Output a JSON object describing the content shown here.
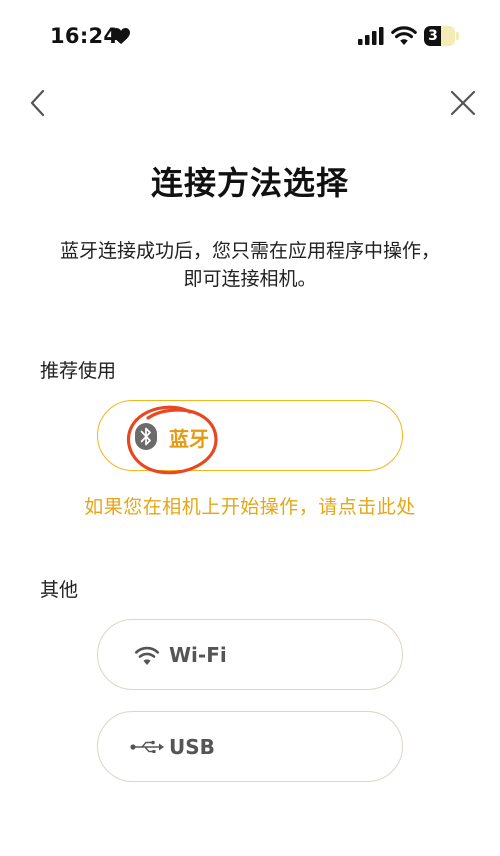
{
  "status_bar": {
    "time": "16:24",
    "battery_level": "3",
    "battery_fraction": 0.3,
    "icons": [
      "heart-icon",
      "cellular-signal-icon",
      "wifi-icon",
      "battery-icon"
    ]
  },
  "nav": {
    "back_icon": "chevron-left-icon",
    "close_icon": "close-icon"
  },
  "title": "连接方法选择",
  "description_line1": "蓝牙连接成功后，您只需在应用程序中操作，",
  "description_line2": "即可连接相机。",
  "recommended": {
    "label": "推荐使用",
    "bluetooth": {
      "label": "蓝牙",
      "icon": "bluetooth-icon"
    },
    "hint": "如果您在相机上开始操作，请点击此处"
  },
  "other": {
    "label": "其他",
    "wifi": {
      "label": "Wi-Fi",
      "icon": "wifi-icon"
    },
    "usb": {
      "label": "USB",
      "icon": "usb-icon"
    }
  },
  "colors": {
    "accent": "#F2B618",
    "accent_text": "#E49B0F",
    "annotation": "#E8471F",
    "neutral_border": "#DCD6C4"
  }
}
